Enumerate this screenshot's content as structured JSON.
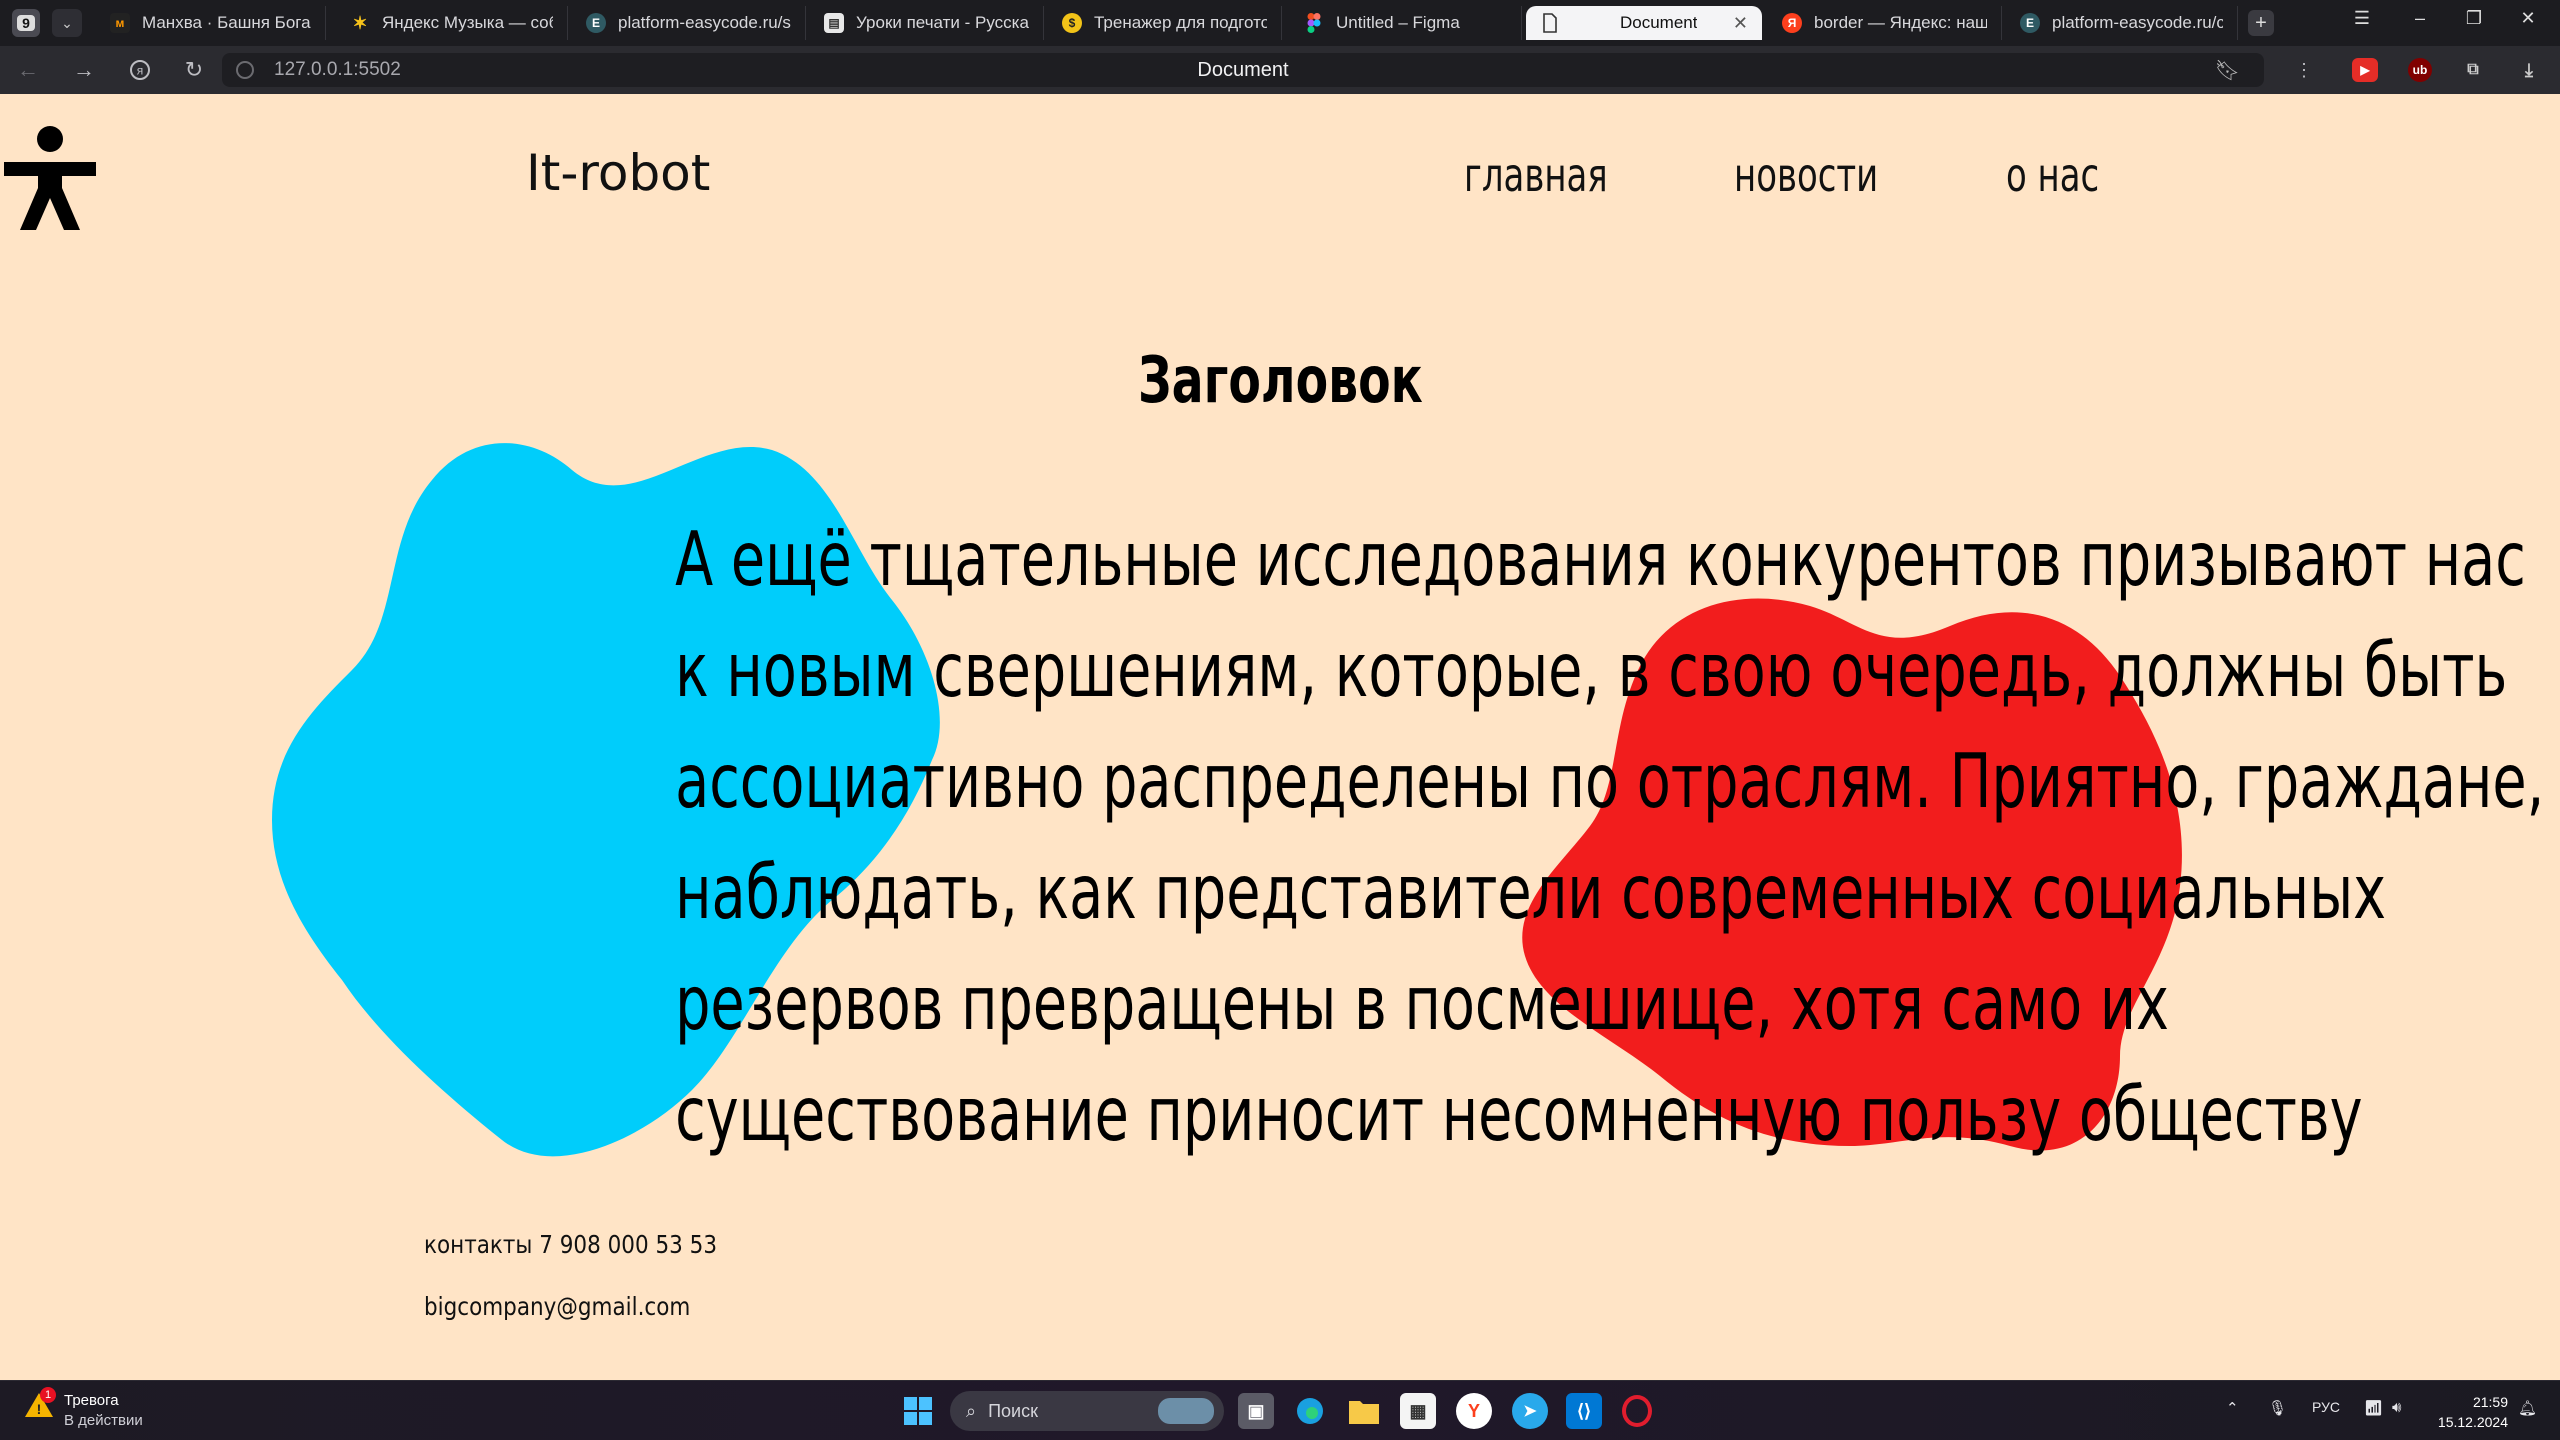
{
  "browser": {
    "tab_count": "9",
    "tabs": [
      {
        "title": "Манхва · Башня Бога · Ч",
        "icon": "mangalib-icon",
        "color": "#222"
      },
      {
        "title": "Яндекс Музыка — собир",
        "icon": "yandex-music-icon",
        "color": "#f6c21b"
      },
      {
        "title": "platform-easycode.ru/su",
        "icon": "easycode-icon",
        "color": "#3b6e7a"
      },
      {
        "title": "Уроки печати - Русская",
        "icon": "typing-icon",
        "color": "#e8e8e8"
      },
      {
        "title": "Тренажер для подготов",
        "icon": "coin-icon",
        "color": "#f2c318"
      },
      {
        "title": "Untitled – Figma",
        "icon": "figma-icon",
        "color": "#f24e1e"
      },
      {
        "title": "Document",
        "icon": "document-icon",
        "color": "#ffffff",
        "active": true
      },
      {
        "title": "border — Яндекс: нашло",
        "icon": "yandex-icon",
        "color": "#fc3f1d"
      },
      {
        "title": "platform-easycode.ru/co",
        "icon": "easycode-icon",
        "color": "#3b6e7a"
      }
    ],
    "url": "127.0.0.1:5502",
    "page_title": "Document"
  },
  "page": {
    "logo": "It-robot",
    "nav": [
      "главная",
      "новости",
      "о нас"
    ],
    "heading": "Заголовок",
    "body_lines": [
      "А ещё тщательные исследования конкурентов призывают нас",
      "к новым свершениям, которые, в свою очередь, должны быть",
      "ассоциативно распределены по отраслям. Приятно, граждане,",
      "наблюдать, как представители современных социальных",
      "резервов превращены в посмешище, хотя само их",
      "существование приносит несомненную пользу обществу"
    ],
    "contact_phone": "контакты 7 908 000 53 53",
    "contact_email": "bigcompany@gmail.com",
    "colors": {
      "background": "#ffe4c6",
      "blob_blue": "#00cdfb",
      "blob_red": "#f21d1d"
    }
  },
  "taskbar": {
    "alert_title": "Тревога",
    "alert_subtitle": "В действии",
    "alert_badge": "1",
    "search_placeholder": "Поиск",
    "language": "РУС",
    "time": "21:59",
    "date": "15.12.2024"
  }
}
